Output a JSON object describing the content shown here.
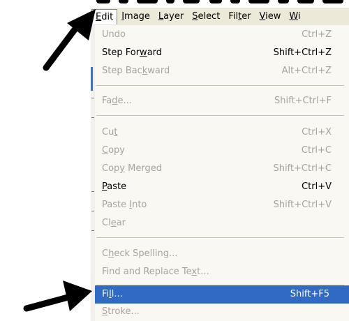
{
  "menubar": {
    "items": [
      {
        "label": "Edit",
        "accel": "E",
        "rest": "dit"
      },
      {
        "label": "Image",
        "accel": "I",
        "rest": "mage"
      },
      {
        "label": "Layer",
        "accel": "L",
        "rest": "ayer"
      },
      {
        "label": "Select",
        "accel": "S",
        "rest": "elect"
      },
      {
        "label": "Filter",
        "pre": "Fil",
        "accel": "t",
        "rest": "er"
      },
      {
        "label": "View",
        "accel": "V",
        "rest": "iew"
      },
      {
        "label": "Window",
        "accel": "W",
        "rest": "i"
      }
    ]
  },
  "menu": {
    "undo": {
      "pre": "Undo",
      "accel": "",
      "post": "",
      "shortcut": "Ctrl+Z"
    },
    "step_forward": {
      "pre": "Step For",
      "accel": "w",
      "post": "ard",
      "shortcut": "Shift+Ctrl+Z"
    },
    "step_backward": {
      "pre": "Step Bac",
      "accel": "k",
      "post": "ward",
      "shortcut": "Alt+Ctrl+Z"
    },
    "fade": {
      "pre": "Fa",
      "accel": "d",
      "post": "e...",
      "shortcut": "Shift+Ctrl+F"
    },
    "cut": {
      "pre": "Cu",
      "accel": "t",
      "post": "",
      "shortcut": "Ctrl+X"
    },
    "copy": {
      "pre": "",
      "accel": "C",
      "post": "opy",
      "shortcut": "Ctrl+C"
    },
    "copy_merged": {
      "pre": "Cop",
      "accel": "y",
      "post": " Merged",
      "shortcut": "Shift+Ctrl+C"
    },
    "paste": {
      "pre": "",
      "accel": "P",
      "post": "aste",
      "shortcut": "Ctrl+V"
    },
    "paste_into": {
      "pre": "Paste ",
      "accel": "I",
      "post": "nto",
      "shortcut": "Shift+Ctrl+V"
    },
    "clear": {
      "pre": "Cl",
      "accel": "e",
      "post": "ar",
      "shortcut": ""
    },
    "check_spelling": {
      "pre": "C",
      "accel": "h",
      "post": "eck Spelling...",
      "shortcut": ""
    },
    "find_replace": {
      "pre": "Find and Replace Te",
      "accel": "x",
      "post": "t...",
      "shortcut": ""
    },
    "fill": {
      "pre": "Fi",
      "accel": "l",
      "post": "l...",
      "shortcut": "Shift+F5"
    },
    "stroke": {
      "pre": "",
      "accel": "S",
      "post": "troke...",
      "shortcut": ""
    }
  },
  "colors": {
    "highlight": "#316ac5",
    "disabled_text": "#a7a49a",
    "menubar_bg": "#ece9d8",
    "menu_bg": "#f9f8f3"
  }
}
